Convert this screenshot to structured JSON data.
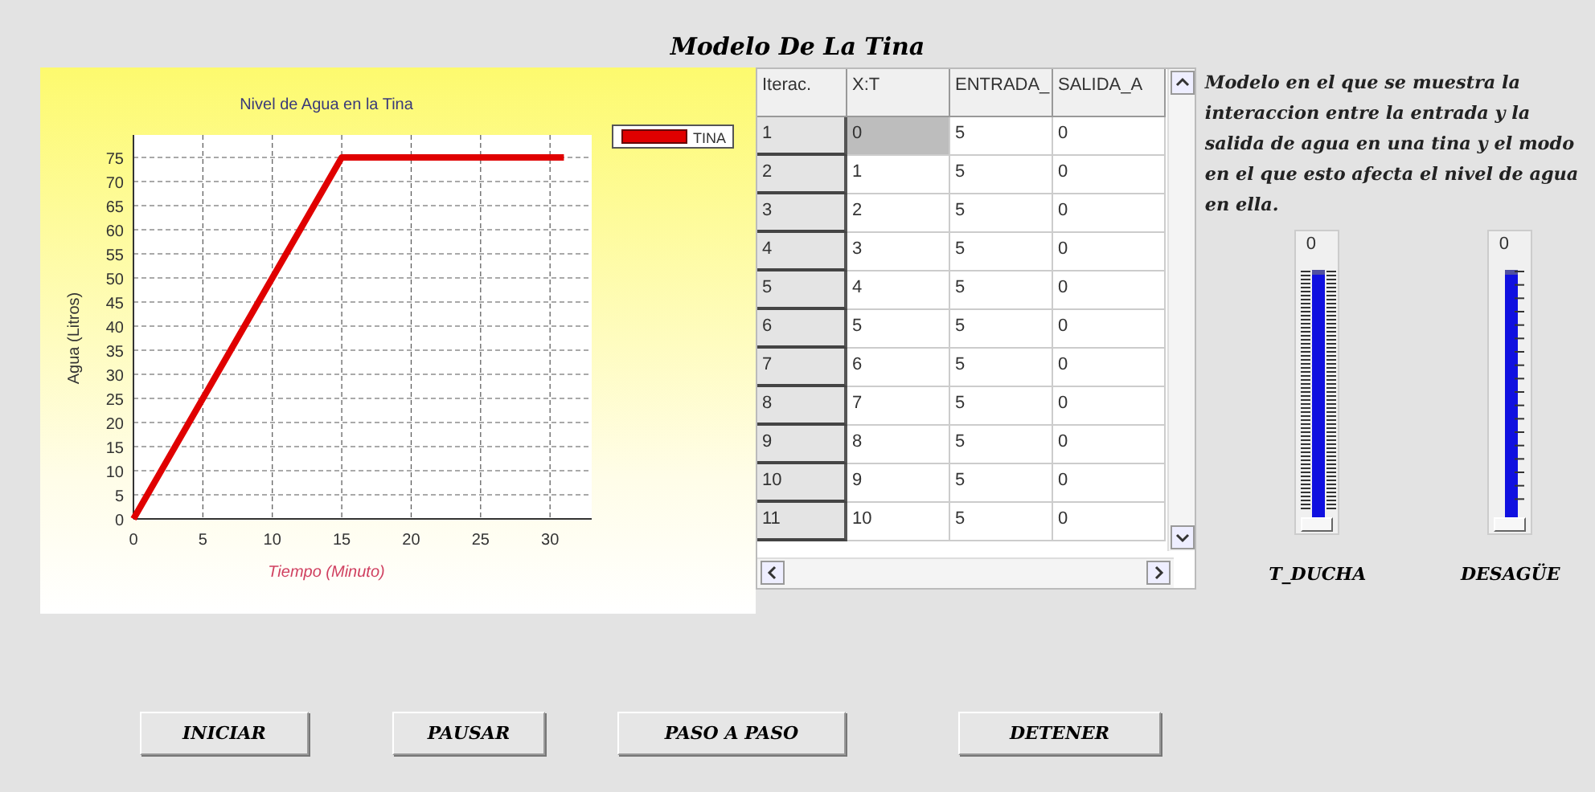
{
  "window": {
    "title": "Modelo De La Tina"
  },
  "chart": {
    "chart_data": {
      "type": "line",
      "title": "Nivel de Agua en la Tina",
      "xlabel": "Tiempo (Minuto)",
      "ylabel": "Agua (Litros)",
      "x": [
        0,
        1,
        2,
        3,
        4,
        5,
        6,
        7,
        8,
        9,
        10,
        11,
        12,
        13,
        14,
        15,
        16,
        17,
        18,
        19,
        20,
        21,
        22,
        23,
        24,
        25,
        26,
        27,
        28,
        29,
        30,
        31
      ],
      "series": [
        {
          "name": "TINA",
          "color": "#e00000",
          "values": [
            0,
            5,
            10,
            15,
            20,
            25,
            30,
            35,
            40,
            45,
            50,
            55,
            60,
            65,
            70,
            75,
            75,
            75,
            75,
            75,
            75,
            75,
            75,
            75,
            75,
            75,
            75,
            75,
            75,
            75,
            75,
            75
          ]
        }
      ],
      "xlim": [
        0,
        33
      ],
      "grid": true,
      "ylim": [
        0,
        75
      ],
      "xticks": [
        0,
        5,
        10,
        15,
        20,
        25,
        30
      ],
      "yticks": [
        0,
        5,
        10,
        15,
        20,
        25,
        30,
        35,
        40,
        45,
        50,
        55,
        60,
        65,
        70,
        75
      ]
    }
  },
  "table": {
    "columns": [
      "Iterac.",
      "X:T",
      "ENTRADA_",
      "SALIDA_A"
    ],
    "rows": [
      {
        "cells": [
          {
            "text": "1",
            "selected": false
          },
          {
            "text": "0",
            "selected": true
          },
          {
            "text": "5",
            "selected": false
          },
          {
            "text": "0",
            "selected": false
          }
        ]
      },
      {
        "cells": [
          {
            "text": "2",
            "selected": false
          },
          {
            "text": "1",
            "selected": false
          },
          {
            "text": "5",
            "selected": false
          },
          {
            "text": "0",
            "selected": false
          }
        ]
      },
      {
        "cells": [
          {
            "text": "3",
            "selected": false
          },
          {
            "text": "2",
            "selected": false
          },
          {
            "text": "5",
            "selected": false
          },
          {
            "text": "0",
            "selected": false
          }
        ]
      },
      {
        "cells": [
          {
            "text": "4",
            "selected": false
          },
          {
            "text": "3",
            "selected": false
          },
          {
            "text": "5",
            "selected": false
          },
          {
            "text": "0",
            "selected": false
          }
        ]
      },
      {
        "cells": [
          {
            "text": "5",
            "selected": false
          },
          {
            "text": "4",
            "selected": false
          },
          {
            "text": "5",
            "selected": false
          },
          {
            "text": "0",
            "selected": false
          }
        ]
      },
      {
        "cells": [
          {
            "text": "6",
            "selected": false
          },
          {
            "text": "5",
            "selected": false
          },
          {
            "text": "5",
            "selected": false
          },
          {
            "text": "0",
            "selected": false
          }
        ]
      },
      {
        "cells": [
          {
            "text": "7",
            "selected": false
          },
          {
            "text": "6",
            "selected": false
          },
          {
            "text": "5",
            "selected": false
          },
          {
            "text": "0",
            "selected": false
          }
        ]
      },
      {
        "cells": [
          {
            "text": "8",
            "selected": false
          },
          {
            "text": "7",
            "selected": false
          },
          {
            "text": "5",
            "selected": false
          },
          {
            "text": "0",
            "selected": false
          }
        ]
      },
      {
        "cells": [
          {
            "text": "9",
            "selected": false
          },
          {
            "text": "8",
            "selected": false
          },
          {
            "text": "5",
            "selected": false
          },
          {
            "text": "0",
            "selected": false
          }
        ]
      },
      {
        "cells": [
          {
            "text": "10",
            "selected": false
          },
          {
            "text": "9",
            "selected": false
          },
          {
            "text": "5",
            "selected": false
          },
          {
            "text": "0",
            "selected": false
          }
        ]
      },
      {
        "cells": [
          {
            "text": "11",
            "selected": false
          },
          {
            "text": "10",
            "selected": false
          },
          {
            "text": "5",
            "selected": false
          },
          {
            "text": "0",
            "selected": false
          }
        ]
      }
    ]
  },
  "description": "Modelo en el que se muestra la interaccion entre la entrada y la salida de agua en una tina y el modo en el que esto afecta el nivel de agua en ella.",
  "sliders": [
    {
      "value": "0",
      "label": "T_DUCHA",
      "level": 0,
      "kind": "dense"
    },
    {
      "value": "0",
      "label": "DESAGÜE",
      "level": 0,
      "kind": "sparse"
    }
  ],
  "buttons": [
    "INICIAR",
    "PAUSAR",
    "PASO A PASO",
    "DETENER"
  ]
}
